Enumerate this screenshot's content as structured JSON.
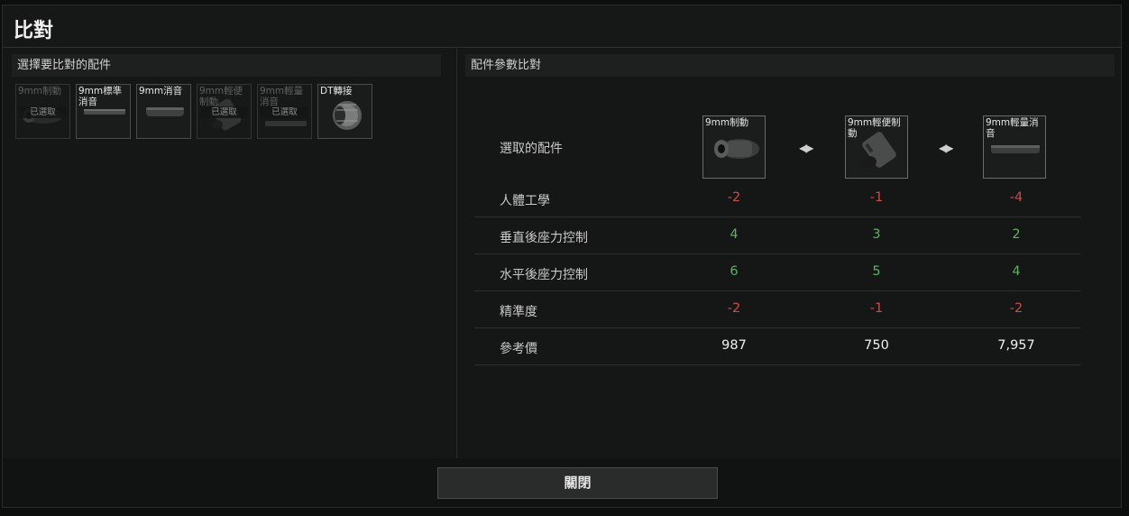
{
  "window": {
    "title": "比對"
  },
  "left": {
    "header": "選擇要比對的配件",
    "slots": [
      {
        "label": "9mm制動",
        "badge": "已選取",
        "dim": true,
        "icon": "muzzle-brake-icon"
      },
      {
        "label": "9mm標準消音",
        "badge": "",
        "dim": false,
        "icon": "suppressor-icon"
      },
      {
        "label": "9mm消音",
        "badge": "",
        "dim": false,
        "icon": "suppressor-icon"
      },
      {
        "label": "9mm輕便制動",
        "badge": "已選取",
        "dim": true,
        "icon": "compensator-icon"
      },
      {
        "label": "9mm輕量消音",
        "badge": "已選取",
        "dim": true,
        "icon": "suppressor-icon"
      },
      {
        "label": "DT轉接",
        "badge": "",
        "dim": false,
        "icon": "adapter-icon"
      }
    ]
  },
  "right": {
    "header": "配件參數比對",
    "selected_label": "選取的配件",
    "selected": [
      {
        "label": "9mm制動",
        "icon": "muzzle-brake-icon"
      },
      {
        "label": "9mm輕便制動",
        "icon": "compensator-icon"
      },
      {
        "label": "9mm輕量消音",
        "icon": "suppressor-icon"
      }
    ],
    "rows": [
      {
        "label": "人體工學",
        "values": [
          "-2",
          "-1",
          "-4"
        ],
        "tone": [
          "neg",
          "neg",
          "neg"
        ]
      },
      {
        "label": "垂直後座力控制",
        "values": [
          "4",
          "3",
          "2"
        ],
        "tone": [
          "pos",
          "pos",
          "pos"
        ]
      },
      {
        "label": "水平後座力控制",
        "values": [
          "6",
          "5",
          "4"
        ],
        "tone": [
          "pos",
          "pos",
          "pos"
        ]
      },
      {
        "label": "精準度",
        "values": [
          "-2",
          "-1",
          "-2"
        ],
        "tone": [
          "neg",
          "neg",
          "neg"
        ]
      },
      {
        "label": "參考價",
        "values": [
          "987",
          "750",
          "7,957"
        ],
        "tone": [
          "neu",
          "neu",
          "neu"
        ]
      }
    ]
  },
  "footer": {
    "close_label": "關閉"
  },
  "colors": {
    "negative": "#d04a44",
    "positive": "#5fb060",
    "neutral": "#f0f0f0"
  }
}
